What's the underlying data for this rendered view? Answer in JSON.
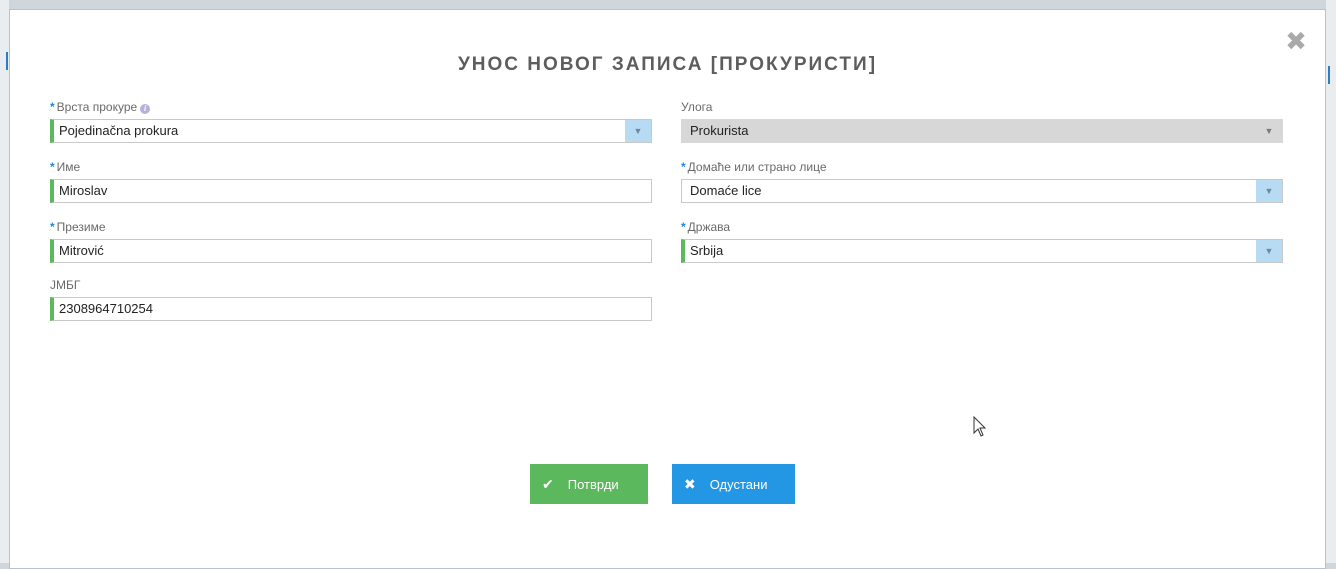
{
  "dialog": {
    "title": "УНОС НОВОГ ЗАПИСА [ПРОКУРИСТИ]",
    "close_icon": "close-icon"
  },
  "fields": {
    "procura_type": {
      "label": "Врста прокуре",
      "value": "Pojedinačna prokura",
      "required": true
    },
    "first_name": {
      "label": "Име",
      "value": "Miroslav",
      "required": true
    },
    "last_name": {
      "label": "Презиме",
      "value": "Mitrović",
      "required": true
    },
    "jmbg": {
      "label": "ЈМБГ",
      "value": "2308964710254",
      "required": false
    },
    "role": {
      "label": "Улога",
      "value": "Prokurista",
      "required": false
    },
    "domestic_foreign": {
      "label": "Домаће или страно лице",
      "value": "Domaće lice",
      "required": true
    },
    "country": {
      "label": "Држава",
      "value": "Srbija",
      "required": true
    }
  },
  "buttons": {
    "confirm": "Потврди",
    "cancel": "Одустани"
  },
  "colors": {
    "required_star": "#1e88e5",
    "valid_border": "#5cb85c",
    "confirm": "#5cb85c",
    "cancel": "#2396e4",
    "caret_bg": "#b6dbf3"
  }
}
